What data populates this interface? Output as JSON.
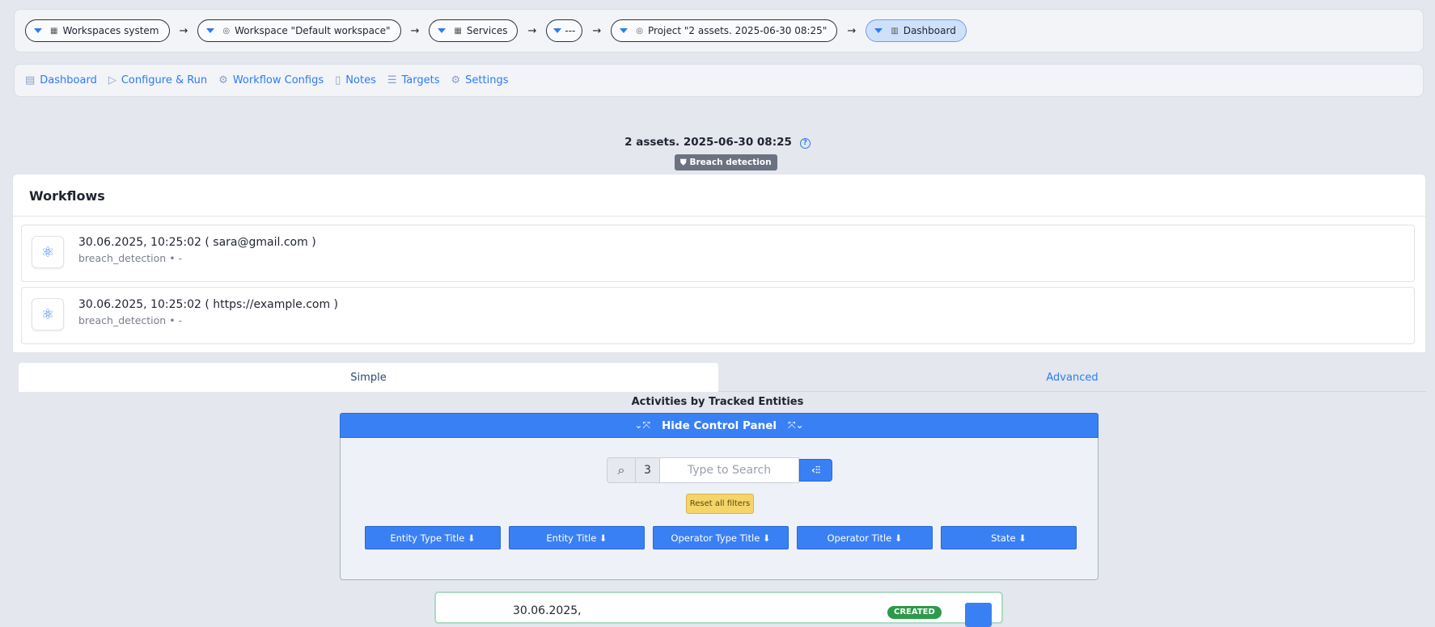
{
  "breadcrumbs": [
    {
      "label": "Workspaces system",
      "icon": "grid-icon"
    },
    {
      "label": "Workspace \"Default workspace\"",
      "icon": "target-icon"
    },
    {
      "label": "Services",
      "icon": "grid-icon"
    },
    {
      "label": "---",
      "icon": ""
    },
    {
      "label": "Project \"2 assets. 2025-06-30 08:25\"",
      "icon": "target-icon"
    },
    {
      "label": "Dashboard",
      "icon": "table-icon"
    }
  ],
  "nav": [
    {
      "label": "Dashboard",
      "icon": "book-icon"
    },
    {
      "label": "Configure & Run",
      "icon": "play-icon"
    },
    {
      "label": "Workflow Configs",
      "icon": "cogs-icon"
    },
    {
      "label": "Notes",
      "icon": "note-icon"
    },
    {
      "label": "Targets",
      "icon": "list-icon"
    },
    {
      "label": "Settings",
      "icon": "gear-icon"
    }
  ],
  "project": {
    "title": "2 assets. 2025-06-30 08:25",
    "badge": "Breach detection"
  },
  "workflows": {
    "title": "Workflows",
    "items": [
      {
        "title": "30.06.2025, 10:25:02 ( sara@gmail.com )",
        "subtitle": "breach_detection • -"
      },
      {
        "title": "30.06.2025, 10:25:02 ( https://example.com )",
        "subtitle": "breach_detection • -"
      }
    ]
  },
  "tabs": {
    "simple": "Simple",
    "advanced": "Advanced"
  },
  "activities": {
    "title": "Activities by Tracked Entities",
    "control_toggle": "Hide Control Panel",
    "search": {
      "count": "3",
      "placeholder": "Type to Search"
    },
    "reset_label": "Reset all filters",
    "columns": [
      "Entity Type Title ⬇",
      "Entity Title ⬇",
      "Operator Type Title ⬇",
      "Operator Title ⬇",
      "State ⬇"
    ],
    "result": {
      "date": "30.06.2025,",
      "state": "CREATED"
    }
  },
  "colors": {
    "accent": "#3a80f5",
    "badge": "#6b7280",
    "reset": "#f5d46a",
    "created": "#2c9a4a"
  }
}
